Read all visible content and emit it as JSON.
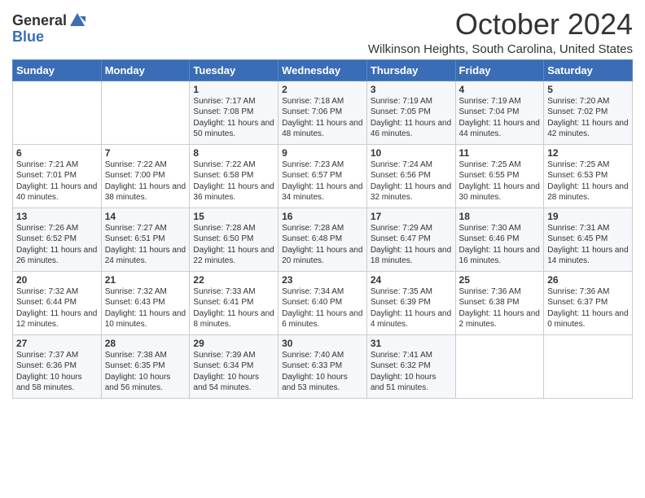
{
  "header": {
    "logo_general": "General",
    "logo_blue": "Blue",
    "month_title": "October 2024",
    "location": "Wilkinson Heights, South Carolina, United States"
  },
  "days_of_week": [
    "Sunday",
    "Monday",
    "Tuesday",
    "Wednesday",
    "Thursday",
    "Friday",
    "Saturday"
  ],
  "weeks": [
    [
      {
        "day": "",
        "sunrise": "",
        "sunset": "",
        "daylight": ""
      },
      {
        "day": "",
        "sunrise": "",
        "sunset": "",
        "daylight": ""
      },
      {
        "day": "1",
        "sunrise": "Sunrise: 7:17 AM",
        "sunset": "Sunset: 7:08 PM",
        "daylight": "Daylight: 11 hours and 50 minutes."
      },
      {
        "day": "2",
        "sunrise": "Sunrise: 7:18 AM",
        "sunset": "Sunset: 7:06 PM",
        "daylight": "Daylight: 11 hours and 48 minutes."
      },
      {
        "day": "3",
        "sunrise": "Sunrise: 7:19 AM",
        "sunset": "Sunset: 7:05 PM",
        "daylight": "Daylight: 11 hours and 46 minutes."
      },
      {
        "day": "4",
        "sunrise": "Sunrise: 7:19 AM",
        "sunset": "Sunset: 7:04 PM",
        "daylight": "Daylight: 11 hours and 44 minutes."
      },
      {
        "day": "5",
        "sunrise": "Sunrise: 7:20 AM",
        "sunset": "Sunset: 7:02 PM",
        "daylight": "Daylight: 11 hours and 42 minutes."
      }
    ],
    [
      {
        "day": "6",
        "sunrise": "Sunrise: 7:21 AM",
        "sunset": "Sunset: 7:01 PM",
        "daylight": "Daylight: 11 hours and 40 minutes."
      },
      {
        "day": "7",
        "sunrise": "Sunrise: 7:22 AM",
        "sunset": "Sunset: 7:00 PM",
        "daylight": "Daylight: 11 hours and 38 minutes."
      },
      {
        "day": "8",
        "sunrise": "Sunrise: 7:22 AM",
        "sunset": "Sunset: 6:58 PM",
        "daylight": "Daylight: 11 hours and 36 minutes."
      },
      {
        "day": "9",
        "sunrise": "Sunrise: 7:23 AM",
        "sunset": "Sunset: 6:57 PM",
        "daylight": "Daylight: 11 hours and 34 minutes."
      },
      {
        "day": "10",
        "sunrise": "Sunrise: 7:24 AM",
        "sunset": "Sunset: 6:56 PM",
        "daylight": "Daylight: 11 hours and 32 minutes."
      },
      {
        "day": "11",
        "sunrise": "Sunrise: 7:25 AM",
        "sunset": "Sunset: 6:55 PM",
        "daylight": "Daylight: 11 hours and 30 minutes."
      },
      {
        "day": "12",
        "sunrise": "Sunrise: 7:25 AM",
        "sunset": "Sunset: 6:53 PM",
        "daylight": "Daylight: 11 hours and 28 minutes."
      }
    ],
    [
      {
        "day": "13",
        "sunrise": "Sunrise: 7:26 AM",
        "sunset": "Sunset: 6:52 PM",
        "daylight": "Daylight: 11 hours and 26 minutes."
      },
      {
        "day": "14",
        "sunrise": "Sunrise: 7:27 AM",
        "sunset": "Sunset: 6:51 PM",
        "daylight": "Daylight: 11 hours and 24 minutes."
      },
      {
        "day": "15",
        "sunrise": "Sunrise: 7:28 AM",
        "sunset": "Sunset: 6:50 PM",
        "daylight": "Daylight: 11 hours and 22 minutes."
      },
      {
        "day": "16",
        "sunrise": "Sunrise: 7:28 AM",
        "sunset": "Sunset: 6:48 PM",
        "daylight": "Daylight: 11 hours and 20 minutes."
      },
      {
        "day": "17",
        "sunrise": "Sunrise: 7:29 AM",
        "sunset": "Sunset: 6:47 PM",
        "daylight": "Daylight: 11 hours and 18 minutes."
      },
      {
        "day": "18",
        "sunrise": "Sunrise: 7:30 AM",
        "sunset": "Sunset: 6:46 PM",
        "daylight": "Daylight: 11 hours and 16 minutes."
      },
      {
        "day": "19",
        "sunrise": "Sunrise: 7:31 AM",
        "sunset": "Sunset: 6:45 PM",
        "daylight": "Daylight: 11 hours and 14 minutes."
      }
    ],
    [
      {
        "day": "20",
        "sunrise": "Sunrise: 7:32 AM",
        "sunset": "Sunset: 6:44 PM",
        "daylight": "Daylight: 11 hours and 12 minutes."
      },
      {
        "day": "21",
        "sunrise": "Sunrise: 7:32 AM",
        "sunset": "Sunset: 6:43 PM",
        "daylight": "Daylight: 11 hours and 10 minutes."
      },
      {
        "day": "22",
        "sunrise": "Sunrise: 7:33 AM",
        "sunset": "Sunset: 6:41 PM",
        "daylight": "Daylight: 11 hours and 8 minutes."
      },
      {
        "day": "23",
        "sunrise": "Sunrise: 7:34 AM",
        "sunset": "Sunset: 6:40 PM",
        "daylight": "Daylight: 11 hours and 6 minutes."
      },
      {
        "day": "24",
        "sunrise": "Sunrise: 7:35 AM",
        "sunset": "Sunset: 6:39 PM",
        "daylight": "Daylight: 11 hours and 4 minutes."
      },
      {
        "day": "25",
        "sunrise": "Sunrise: 7:36 AM",
        "sunset": "Sunset: 6:38 PM",
        "daylight": "Daylight: 11 hours and 2 minutes."
      },
      {
        "day": "26",
        "sunrise": "Sunrise: 7:36 AM",
        "sunset": "Sunset: 6:37 PM",
        "daylight": "Daylight: 11 hours and 0 minutes."
      }
    ],
    [
      {
        "day": "27",
        "sunrise": "Sunrise: 7:37 AM",
        "sunset": "Sunset: 6:36 PM",
        "daylight": "Daylight: 10 hours and 58 minutes."
      },
      {
        "day": "28",
        "sunrise": "Sunrise: 7:38 AM",
        "sunset": "Sunset: 6:35 PM",
        "daylight": "Daylight: 10 hours and 56 minutes."
      },
      {
        "day": "29",
        "sunrise": "Sunrise: 7:39 AM",
        "sunset": "Sunset: 6:34 PM",
        "daylight": "Daylight: 10 hours and 54 minutes."
      },
      {
        "day": "30",
        "sunrise": "Sunrise: 7:40 AM",
        "sunset": "Sunset: 6:33 PM",
        "daylight": "Daylight: 10 hours and 53 minutes."
      },
      {
        "day": "31",
        "sunrise": "Sunrise: 7:41 AM",
        "sunset": "Sunset: 6:32 PM",
        "daylight": "Daylight: 10 hours and 51 minutes."
      },
      {
        "day": "",
        "sunrise": "",
        "sunset": "",
        "daylight": ""
      },
      {
        "day": "",
        "sunrise": "",
        "sunset": "",
        "daylight": ""
      }
    ]
  ]
}
